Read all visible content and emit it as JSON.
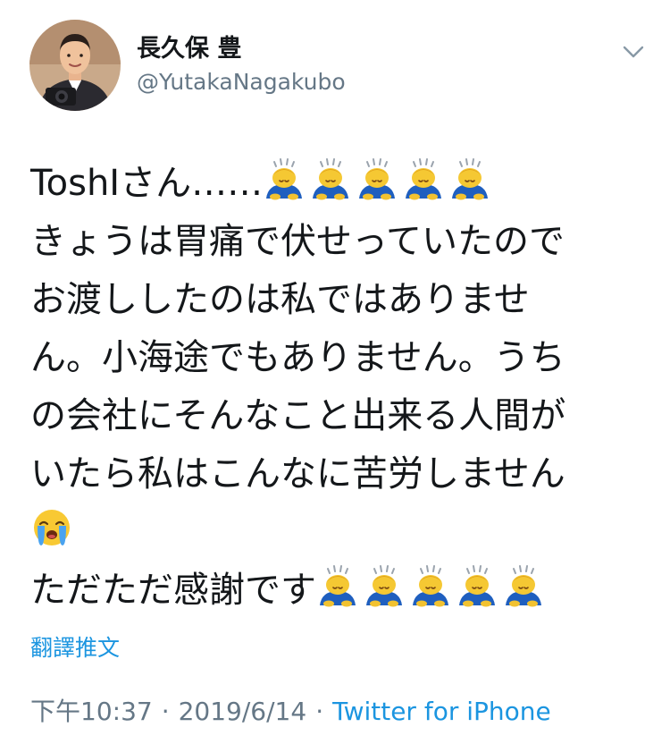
{
  "author": {
    "display_name": "長久保 豊",
    "handle": "@YutakaNagakubo"
  },
  "icons": {
    "avatar": "profile-photo-illustration",
    "menu": "chevron-down-icon",
    "bow": "person-bowing-emoji",
    "cry": "loudly-crying-face-emoji"
  },
  "tweet": {
    "line1": "ToshIさん……",
    "line2": "きょうは胃痛で伏せっていたので",
    "line3": "お渡ししたのは私ではありませ",
    "line4": "ん。小海途でもありません。うち",
    "line5": "の会社にそんなこと出来る人間が",
    "line6": "いたら私はこんなに苦労しません",
    "line8": "ただただ感謝です"
  },
  "translate_label": "翻譯推文",
  "meta": {
    "time": "下午10:37",
    "separator": "·",
    "date": "2019/6/14",
    "source": "Twitter for iPhone"
  },
  "colors": {
    "text": "#14171a",
    "secondary": "#657786",
    "link": "#1b95e0"
  }
}
